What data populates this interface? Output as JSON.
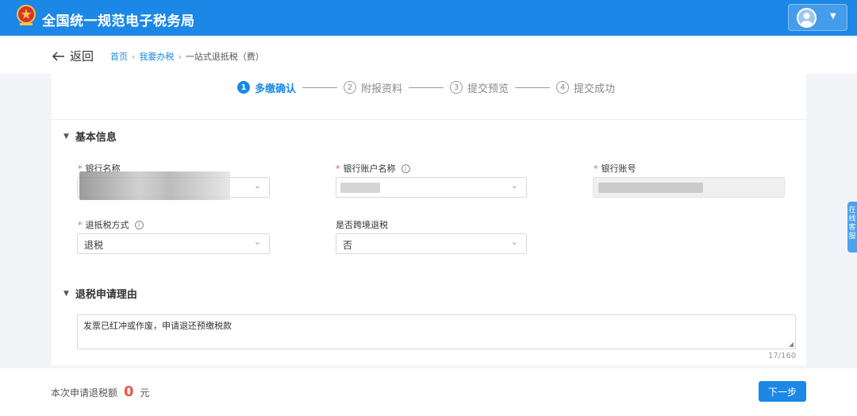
{
  "app": {
    "title": "全国统一规范电子税务局"
  },
  "colors": {
    "brand": "#1b87e6",
    "required": "#ee5544"
  },
  "nav": {
    "back_label": "返回"
  },
  "breadcrumb": [
    "首页",
    "我要办税",
    "一站式退抵税（费）"
  ],
  "steps": [
    {
      "num": "1",
      "label": "多缴确认",
      "active": true
    },
    {
      "num": "2",
      "label": "附报资料"
    },
    {
      "num": "3",
      "label": "提交预览"
    },
    {
      "num": "4",
      "label": "提交成功"
    }
  ],
  "sections": {
    "basic": {
      "title": "基本信息",
      "bank_name": {
        "label": "银行名称",
        "value": ""
      },
      "account_name": {
        "label": "银行账户名称",
        "value": ""
      },
      "account_no": {
        "label": "银行账号",
        "value": ""
      },
      "refund_method": {
        "label": "退抵税方式",
        "value": "退税"
      },
      "cross_border": {
        "label": "是否跨境退税",
        "value": "否"
      }
    },
    "reason": {
      "title": "退税申请理由",
      "text": "发票已红冲或作废，申请退还预缴税款",
      "counter": "17/160"
    }
  },
  "footer": {
    "amount_label": "本次申请退税额",
    "amount_value": "0",
    "amount_unit": "元",
    "next_label": "下一步"
  },
  "side_tab": {
    "label": "在线客服"
  },
  "icons": [
    "emblem-icon",
    "avatar-icon",
    "chevron-down-icon",
    "back-arrow-icon",
    "info-icon",
    "resize-icon"
  ]
}
